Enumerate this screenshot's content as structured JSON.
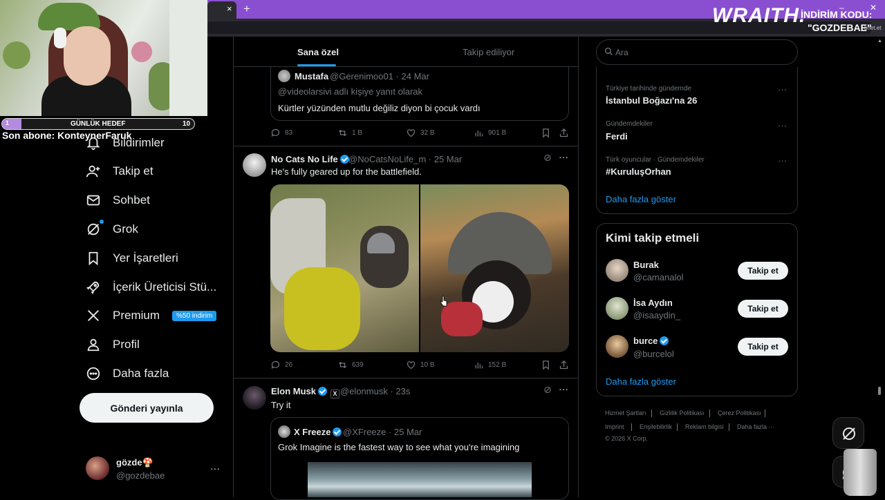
{
  "browser": {
    "tab_close": "×",
    "new_tab": "+",
    "win_min": "–",
    "win_close": "✕"
  },
  "stream_overlay": {
    "brand": "WRAITH.",
    "promo_label": "İNDİRİM KODU:",
    "promo_code": "\"GOZDEBAE\"",
    "promo_small": "bnet.et",
    "goal_current": "1",
    "goal_label": "GÜNLÜK HEDEF",
    "goal_target": "10",
    "goal_progress": 0.1,
    "sub_alert": "Son abone: KonteynerFaruk"
  },
  "nav": {
    "items": [
      {
        "label": "Bildirimler",
        "icon": "bell-icon"
      },
      {
        "label": "Takip et",
        "icon": "follow-icon"
      },
      {
        "label": "Sohbet",
        "icon": "mail-icon"
      },
      {
        "label": "Grok",
        "icon": "grok-icon"
      },
      {
        "label": "Yer İşaretleri",
        "icon": "bookmark-icon"
      },
      {
        "label": "İçerik Üreticisi Stü...",
        "icon": "rocket-icon"
      },
      {
        "label": "Premium",
        "icon": "x-logo-icon",
        "badge": "%50 indirim"
      },
      {
        "label": "Profil",
        "icon": "person-icon"
      },
      {
        "label": "Daha fazla",
        "icon": "more-circle-icon"
      }
    ],
    "post_button": "Gönderi yayınla",
    "profile": {
      "name": "gözde🍄",
      "handle": "@gozdebae",
      "more": "···"
    }
  },
  "feed": {
    "tabs": [
      "Sana özel",
      "Takip ediliyor"
    ],
    "posts": [
      {
        "quote": {
          "name": "Mustafa",
          "meta": "@Gerenimoo01 · 24 Mar",
          "reply_to": "@videolarsivi adlı kişiye yanıt olarak",
          "text": "Kürtler yüzünden mutlu değiliz diyon bi çocuk vardı"
        },
        "stats": {
          "replies": "83",
          "reposts": "1 B",
          "likes": "32 B",
          "views": "901 B"
        }
      },
      {
        "name": "No Cats No Life",
        "meta": "@NoCatsNoLife_m · 25 Mar",
        "text": "He's fully geared up for the battlefield.",
        "stats": {
          "replies": "26",
          "reposts": "639",
          "likes": "10 B",
          "views": "152 B"
        }
      },
      {
        "name": "Elon Musk",
        "meta": "@elonmusk · 23s",
        "text": "Try it",
        "quote": {
          "name": "X Freeze",
          "meta": "@XFreeze · 25 Mar",
          "text": "Grok Imagine is the fastest way to see what you're imagining"
        }
      }
    ]
  },
  "sidebar": {
    "search_placeholder": "Ara",
    "trends": [
      {
        "context": "Türkiye tarihinde gündemde",
        "title": "İstanbul Boğazı'na 26"
      },
      {
        "context": "Gündemdekiler",
        "title": "Ferdi"
      },
      {
        "context": "Türk oyuncular · Gündemdekiler",
        "title": "#KuruluşOrhan"
      }
    ],
    "trend_more": "···",
    "trends_show_more": "Daha fazla göster",
    "who_to_follow": {
      "title": "Kimi takip etmeli",
      "users": [
        {
          "name": "Burak",
          "handle": "@camanalol",
          "button": "Takip et"
        },
        {
          "name": "İsa Aydın",
          "handle": "@isaaydin_",
          "button": "Takip et"
        },
        {
          "name": "burce",
          "handle": "@burcelol",
          "button": "Takip et"
        }
      ],
      "show_more": "Daha fazla göster"
    },
    "footer": [
      "Hizmet Şartları",
      "Gizlilik Politikası",
      "Çerez Politikası",
      "Imprint",
      "Erişilebilirlik",
      "Reklam bilgisi",
      "Daha fazla ···",
      "© 2026 X Corp."
    ]
  },
  "colors": {
    "accent": "#1d9bf0",
    "tabbar": "#8a4fd0",
    "background": "#000000"
  }
}
